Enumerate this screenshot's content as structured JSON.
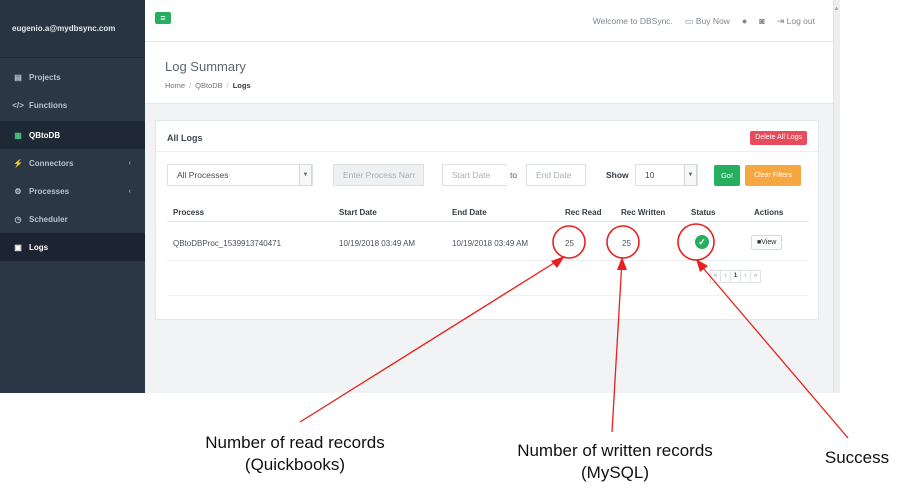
{
  "sidebar": {
    "user": "eugenio.a@mydbsync.com",
    "items": [
      {
        "label": "Projects",
        "icon": "list-icon"
      },
      {
        "label": "Functions",
        "icon": "code-icon"
      },
      {
        "label": "QBtoDB",
        "icon": "grid-icon"
      },
      {
        "label": "Connectors",
        "icon": "plug-icon"
      },
      {
        "label": "Processes",
        "icon": "cogs-icon"
      },
      {
        "label": "Scheduler",
        "icon": "clock-icon"
      },
      {
        "label": "Logs",
        "icon": "log-icon"
      }
    ]
  },
  "topbar": {
    "welcome": "Welcome to DBSync.",
    "buy_now": "Buy Now",
    "logout": "Log out"
  },
  "page": {
    "title": "Log Summary",
    "breadcrumb": [
      "Home",
      "QBtoDB",
      "Logs"
    ]
  },
  "card": {
    "title": "All Logs",
    "delete_all": "Delete All Logs"
  },
  "filters": {
    "process_select": "All Processes",
    "process_name_placeholder": "Enter Process Narr",
    "start_date_placeholder": "Start Date",
    "to_label": "to",
    "end_date_placeholder": "End Date",
    "show_label": "Show",
    "show_value": "10",
    "go": "Go!",
    "clear": "Clear Filters"
  },
  "table": {
    "headers": [
      "Process",
      "Start Date",
      "End Date",
      "Rec Read",
      "Rec Written",
      "Status",
      "Actions"
    ],
    "rows": [
      {
        "process": "QBtoDBProc_1539913740471",
        "start": "10/19/2018 03:49 AM",
        "end": "10/19/2018 03:49 AM",
        "read": "25",
        "written": "25",
        "status": "success",
        "action": "View"
      }
    ]
  },
  "pagination": {
    "first": "«",
    "prev": "‹",
    "page": "1",
    "next": "›",
    "last": "»"
  },
  "annotations": {
    "read": [
      "Number of read records",
      "(Quickbooks)"
    ],
    "written": [
      "Number of written records",
      "(MySQL)"
    ],
    "success": "Success"
  },
  "colors": {
    "annotation": "#e8201e",
    "sidebar": "#2b3744",
    "green": "#27ae60",
    "orange": "#f5a742",
    "red": "#e74c5b"
  }
}
